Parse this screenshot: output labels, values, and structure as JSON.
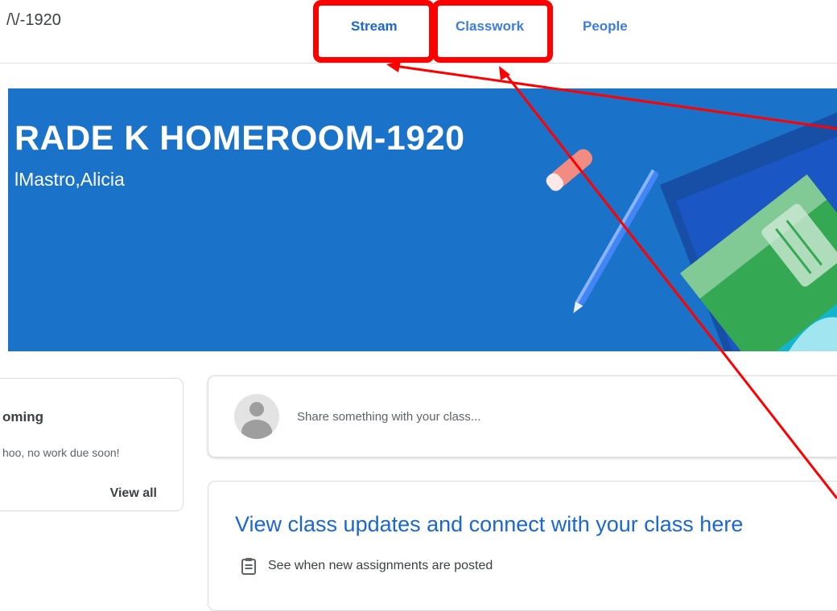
{
  "header": {
    "class_short": "’’-1920",
    "tabs": [
      {
        "label": "Stream",
        "active": true
      },
      {
        "label": "Classwork",
        "active": false
      },
      {
        "label": "People",
        "active": false
      }
    ]
  },
  "banner": {
    "title": "RADE K HOMEROOM-1920",
    "subtitle": "lMastro,Alicia",
    "color": "#1a73c8"
  },
  "upcoming": {
    "title": "oming",
    "text": "hoo, no work due soon!",
    "view_all": "View all"
  },
  "share": {
    "placeholder": "Share something with your class..."
  },
  "updates": {
    "title": "View class updates and connect with your class here",
    "item": "See when new assignments are posted",
    "item_icon": "assignment-icon"
  },
  "annotation": {
    "color": "#ff0000",
    "highlighted_tabs": [
      "Stream",
      "Classwork"
    ]
  }
}
